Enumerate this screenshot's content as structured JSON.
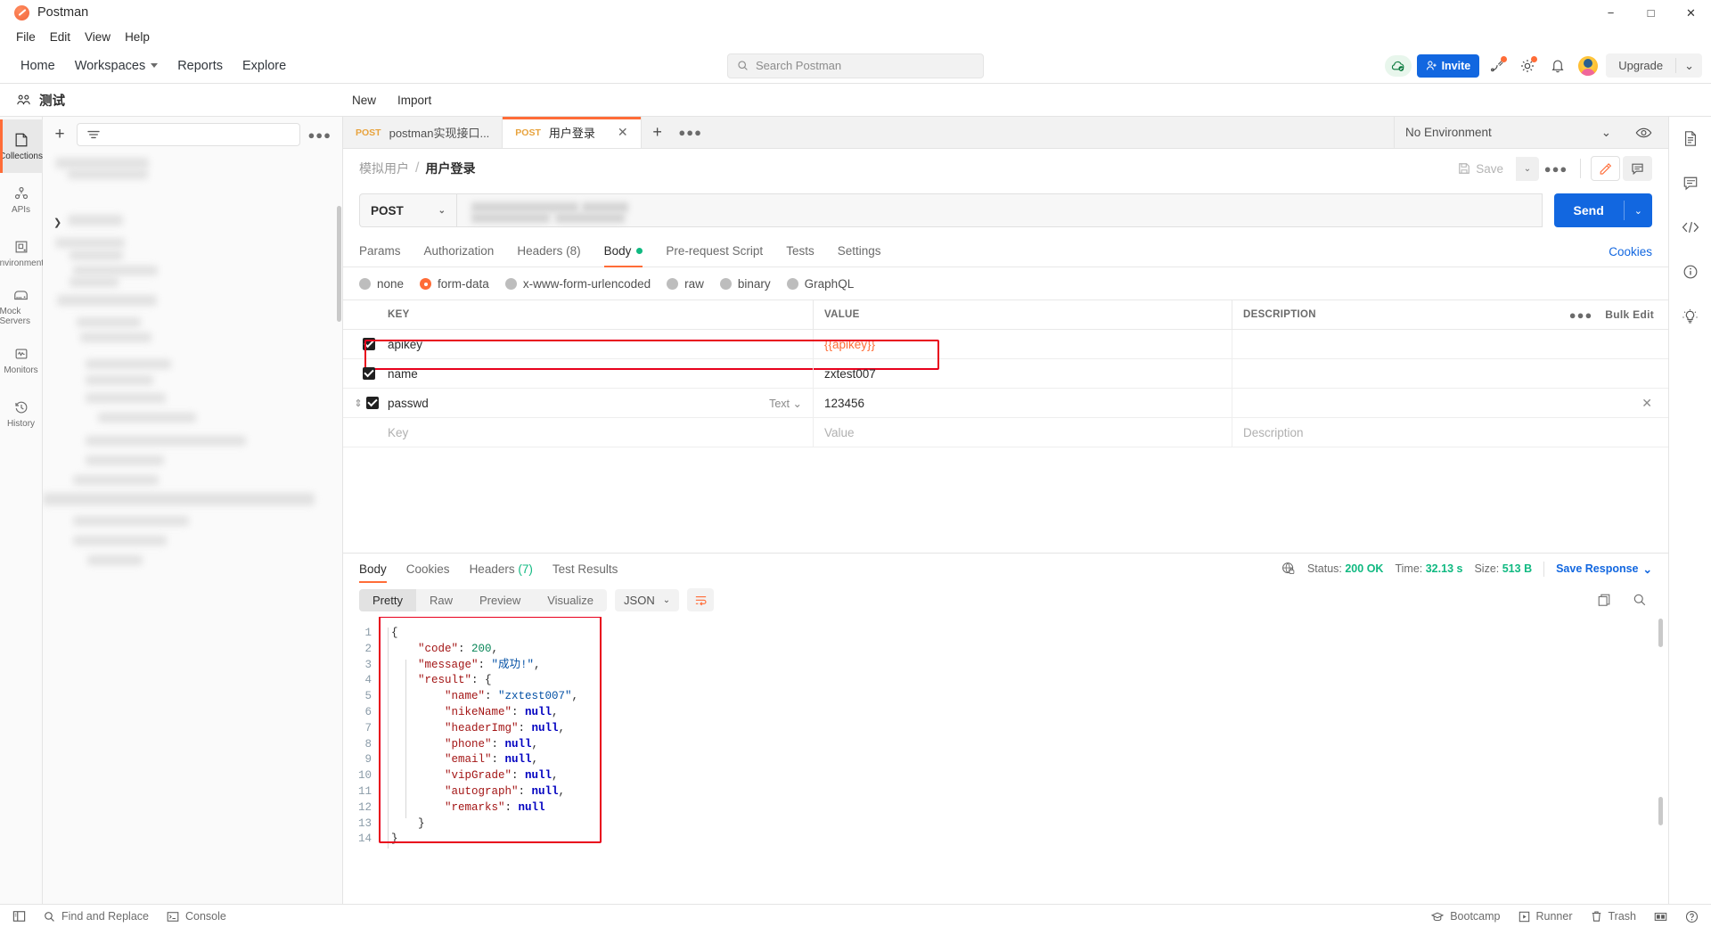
{
  "app": {
    "title": "Postman"
  },
  "window_controls": {
    "minimize": "−",
    "maximize": "□",
    "close": "✕"
  },
  "menubar": [
    "File",
    "Edit",
    "View",
    "Help"
  ],
  "topnav": {
    "links": [
      {
        "label": "Home",
        "has_caret": false
      },
      {
        "label": "Workspaces",
        "has_caret": true
      },
      {
        "label": "Reports",
        "has_caret": false
      },
      {
        "label": "Explore",
        "has_caret": false
      }
    ],
    "search_placeholder": "Search Postman",
    "invite_label": "Invite",
    "upgrade_label": "Upgrade"
  },
  "workspace": {
    "name": "测试",
    "new_label": "New",
    "import_label": "Import"
  },
  "rail": [
    {
      "label": "Collections",
      "icon": "collections-icon",
      "active": true
    },
    {
      "label": "APIs",
      "icon": "apis-icon",
      "active": false
    },
    {
      "label": "Environments",
      "icon": "environments-icon",
      "active": false
    },
    {
      "label": "Mock Servers",
      "icon": "mock-servers-icon",
      "active": false
    },
    {
      "label": "Monitors",
      "icon": "monitors-icon",
      "active": false
    },
    {
      "label": "History",
      "icon": "history-icon",
      "active": false
    }
  ],
  "request_tabs": [
    {
      "method": "POST",
      "label": "postman实现接口...",
      "active": false
    },
    {
      "method": "POST",
      "label": "用户登录",
      "active": true
    }
  ],
  "environment": {
    "selected": "No Environment"
  },
  "breadcrumb": {
    "parent": "模拟用户",
    "separator": "/",
    "current": "用户登录"
  },
  "request_actions": {
    "save_label": "Save"
  },
  "url_bar": {
    "method": "POST",
    "url": ""
  },
  "request_tabs_row": [
    {
      "label": "Params",
      "active": false,
      "dot": false
    },
    {
      "label": "Authorization",
      "active": false,
      "dot": false
    },
    {
      "label": "Headers (8)",
      "active": false,
      "dot": false
    },
    {
      "label": "Body",
      "active": true,
      "dot": true
    },
    {
      "label": "Pre-request Script",
      "active": false,
      "dot": false
    },
    {
      "label": "Tests",
      "active": false,
      "dot": false
    },
    {
      "label": "Settings",
      "active": false,
      "dot": false
    }
  ],
  "cookies_link": "Cookies",
  "body_types": [
    {
      "label": "none",
      "selected": false
    },
    {
      "label": "form-data",
      "selected": true
    },
    {
      "label": "x-www-form-urlencoded",
      "selected": false
    },
    {
      "label": "raw",
      "selected": false
    },
    {
      "label": "binary",
      "selected": false
    },
    {
      "label": "GraphQL",
      "selected": false
    }
  ],
  "kv_table": {
    "headers": {
      "key": "KEY",
      "value": "VALUE",
      "description": "DESCRIPTION"
    },
    "bulk_edit": "Bulk Edit",
    "rows": [
      {
        "checked": true,
        "key": "apikey",
        "value": "{{apikey}}",
        "description": "",
        "value_is_variable": true,
        "highlighted": true,
        "type": "",
        "show_drag": false
      },
      {
        "checked": true,
        "key": "name",
        "value": "zxtest007",
        "description": "",
        "value_is_variable": false,
        "highlighted": false,
        "type": "",
        "show_drag": false
      },
      {
        "checked": true,
        "key": "passwd",
        "value": "123456",
        "description": "",
        "value_is_variable": false,
        "highlighted": false,
        "type": "Text",
        "show_drag": true
      }
    ],
    "placeholder_row": {
      "key": "Key",
      "value": "Value",
      "description": "Description"
    }
  },
  "response": {
    "tabs": [
      {
        "label": "Body",
        "active": true,
        "count": ""
      },
      {
        "label": "Cookies",
        "active": false,
        "count": ""
      },
      {
        "label": "Headers",
        "active": false,
        "count": "(7)"
      },
      {
        "label": "Test Results",
        "active": false,
        "count": ""
      }
    ],
    "meta": {
      "status_label": "Status:",
      "status_value": "200 OK",
      "time_label": "Time:",
      "time_value": "32.13 s",
      "size_label": "Size:",
      "size_value": "513 B",
      "save_response": "Save Response"
    },
    "view_modes": [
      {
        "label": "Pretty",
        "active": true
      },
      {
        "label": "Raw",
        "active": false
      },
      {
        "label": "Preview",
        "active": false
      },
      {
        "label": "Visualize",
        "active": false
      }
    ],
    "format": "JSON",
    "body_lines": [
      {
        "n": 1,
        "indent": 0,
        "tokens": [
          {
            "t": "p",
            "v": "{"
          }
        ]
      },
      {
        "n": 2,
        "indent": 1,
        "tokens": [
          {
            "t": "k",
            "v": "\"code\""
          },
          {
            "t": "p",
            "v": ": "
          },
          {
            "t": "n",
            "v": "200"
          },
          {
            "t": "p",
            "v": ","
          }
        ]
      },
      {
        "n": 3,
        "indent": 1,
        "tokens": [
          {
            "t": "k",
            "v": "\"message\""
          },
          {
            "t": "p",
            "v": ": "
          },
          {
            "t": "s",
            "v": "\"成功!\""
          },
          {
            "t": "p",
            "v": ","
          }
        ]
      },
      {
        "n": 4,
        "indent": 1,
        "tokens": [
          {
            "t": "k",
            "v": "\"result\""
          },
          {
            "t": "p",
            "v": ": {"
          }
        ]
      },
      {
        "n": 5,
        "indent": 2,
        "tokens": [
          {
            "t": "k",
            "v": "\"name\""
          },
          {
            "t": "p",
            "v": ": "
          },
          {
            "t": "s",
            "v": "\"zxtest007\""
          },
          {
            "t": "p",
            "v": ","
          }
        ]
      },
      {
        "n": 6,
        "indent": 2,
        "tokens": [
          {
            "t": "k",
            "v": "\"nikeName\""
          },
          {
            "t": "p",
            "v": ": "
          },
          {
            "t": "nul",
            "v": "null"
          },
          {
            "t": "p",
            "v": ","
          }
        ]
      },
      {
        "n": 7,
        "indent": 2,
        "tokens": [
          {
            "t": "k",
            "v": "\"headerImg\""
          },
          {
            "t": "p",
            "v": ": "
          },
          {
            "t": "nul",
            "v": "null"
          },
          {
            "t": "p",
            "v": ","
          }
        ]
      },
      {
        "n": 8,
        "indent": 2,
        "tokens": [
          {
            "t": "k",
            "v": "\"phone\""
          },
          {
            "t": "p",
            "v": ": "
          },
          {
            "t": "nul",
            "v": "null"
          },
          {
            "t": "p",
            "v": ","
          }
        ]
      },
      {
        "n": 9,
        "indent": 2,
        "tokens": [
          {
            "t": "k",
            "v": "\"email\""
          },
          {
            "t": "p",
            "v": ": "
          },
          {
            "t": "nul",
            "v": "null"
          },
          {
            "t": "p",
            "v": ","
          }
        ]
      },
      {
        "n": 10,
        "indent": 2,
        "tokens": [
          {
            "t": "k",
            "v": "\"vipGrade\""
          },
          {
            "t": "p",
            "v": ": "
          },
          {
            "t": "nul",
            "v": "null"
          },
          {
            "t": "p",
            "v": ","
          }
        ]
      },
      {
        "n": 11,
        "indent": 2,
        "tokens": [
          {
            "t": "k",
            "v": "\"autograph\""
          },
          {
            "t": "p",
            "v": ": "
          },
          {
            "t": "nul",
            "v": "null"
          },
          {
            "t": "p",
            "v": ","
          }
        ]
      },
      {
        "n": 12,
        "indent": 2,
        "tokens": [
          {
            "t": "k",
            "v": "\"remarks\""
          },
          {
            "t": "p",
            "v": ": "
          },
          {
            "t": "nul",
            "v": "null"
          }
        ]
      },
      {
        "n": 13,
        "indent": 1,
        "tokens": [
          {
            "t": "p",
            "v": "}"
          }
        ]
      },
      {
        "n": 14,
        "indent": 0,
        "tokens": [
          {
            "t": "p",
            "v": "}"
          }
        ]
      }
    ]
  },
  "statusbar": {
    "left": [
      {
        "label": "Find and Replace",
        "icon": "search-icon"
      },
      {
        "label": "Console",
        "icon": "console-icon"
      }
    ],
    "right": [
      {
        "label": "Bootcamp",
        "icon": "bootcamp-icon"
      },
      {
        "label": "Runner",
        "icon": "runner-icon"
      },
      {
        "label": "Trash",
        "icon": "trash-icon"
      }
    ]
  },
  "colors": {
    "accent": "#ff6c37",
    "blue": "#1267e0",
    "green": "#10b981",
    "highlight_box": "#e8001c"
  }
}
